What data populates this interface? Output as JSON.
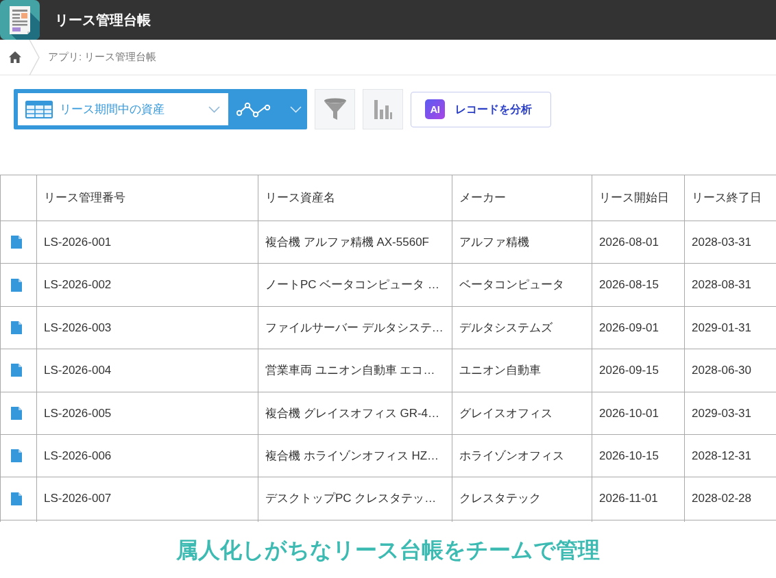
{
  "header": {
    "title": "リース管理台帳"
  },
  "breadcrumb": {
    "text": "アプリ: リース管理台帳"
  },
  "toolbar": {
    "view": "リース期間中の資産",
    "ai_button": {
      "badge": "AI",
      "label": "レコードを分析"
    }
  },
  "table": {
    "columns": [
      "リース管理番号",
      "リース資産名",
      "メーカー",
      "リース開始日",
      "リース終了日"
    ],
    "rows": [
      {
        "cells": [
          "LS-2026-001",
          "複合機 アルファ精機 AX-5560F",
          "アルファ精機",
          "2026-08-01",
          "2028-03-31"
        ]
      },
      {
        "cells": [
          "LS-2026-002",
          "ノートPC ベータコンピュータ …",
          "ベータコンピュータ",
          "2026-08-15",
          "2028-08-31"
        ]
      },
      {
        "cells": [
          "LS-2026-003",
          "ファイルサーバー デルタシステ…",
          "デルタシステムズ",
          "2026-09-01",
          "2029-01-31"
        ]
      },
      {
        "cells": [
          "LS-2026-004",
          "営業車両 ユニオン自動車 エコ…",
          "ユニオン自動車",
          "2026-09-15",
          "2028-06-30"
        ]
      },
      {
        "cells": [
          "LS-2026-005",
          "複合機 グレイスオフィス GR-4…",
          "グレイスオフィス",
          "2026-10-01",
          "2029-03-31"
        ]
      },
      {
        "cells": [
          "LS-2026-006",
          "複合機 ホライゾンオフィス HZ…",
          "ホライゾンオフィス",
          "2026-10-15",
          "2028-12-31"
        ]
      },
      {
        "cells": [
          "LS-2026-007",
          "デスクトップPC クレスタテッ…",
          "クレスタテック",
          "2026-11-01",
          "2028-02-28"
        ]
      }
    ]
  },
  "caption": "属人化しがちなリース台帳をチームで管理"
}
